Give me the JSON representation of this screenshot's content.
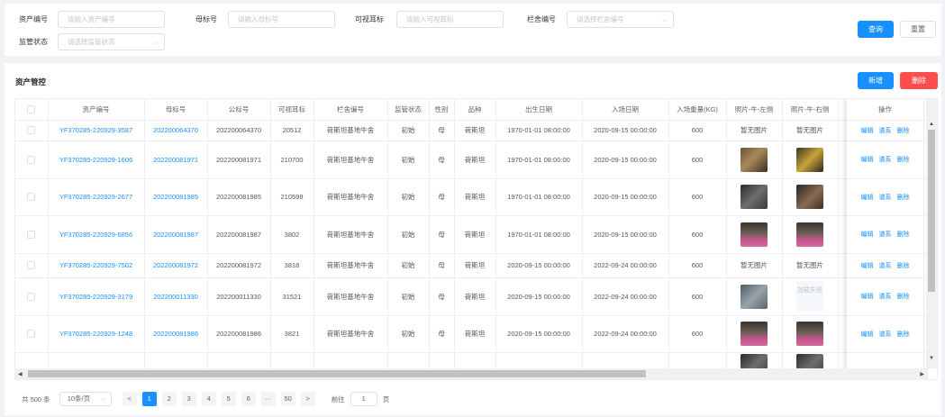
{
  "search": {
    "fields": [
      {
        "label": "资产编号",
        "placeholder": "请输入资产编号"
      },
      {
        "label": "母标号",
        "placeholder": "请输入母标号"
      },
      {
        "label": "可视耳标",
        "placeholder": "请输入可视耳标"
      },
      {
        "label": "栏舍编号",
        "placeholder": "请选择栏舍编号"
      },
      {
        "label": "监管状态",
        "placeholder": "请选择监管状态"
      }
    ],
    "query_label": "查询",
    "reset_label": "重置"
  },
  "section": {
    "title": "资产管控",
    "add_label": "新增",
    "delete_label": "删除"
  },
  "table": {
    "headers": [
      "资产编号",
      "母标号",
      "公标号",
      "可视耳标",
      "栏舍编号",
      "监管状态",
      "性别",
      "品种",
      "出生日期",
      "入场日期",
      "入场重量(KG)",
      "照片-牛-左侧",
      "照片-牛-右侧",
      "操作"
    ],
    "actions": [
      "编辑",
      "谱系",
      "删除"
    ],
    "no_image_label": "暂无图片",
    "load_fail_label": "加载失败",
    "rows": [
      {
        "asset": "YF370285-220929-3587",
        "mother": "202200064370",
        "public": "202200064370",
        "ear": "20512",
        "pen": "荷斯坦基地牛舍",
        "status": "初始",
        "sex": "母",
        "breed": "荷斯坦",
        "birth": "1970-01-01 08:00:00",
        "entry": "2020-09-15 00:00:00",
        "weight": "600",
        "left": "none",
        "right": "none"
      },
      {
        "asset": "YF370285-220929-1606",
        "mother": "202200081971",
        "public": "202200081971",
        "ear": "210700",
        "pen": "荷斯坦基地牛舍",
        "status": "初始",
        "sex": "母",
        "breed": "荷斯坦",
        "birth": "1970-01-01 08:00:00",
        "entry": "2020-09-15 00:00:00",
        "weight": "600",
        "left": "brown",
        "right": "yellow"
      },
      {
        "asset": "YF370285-220929-2677",
        "mother": "202200081985",
        "public": "202200081985",
        "ear": "210598",
        "pen": "荷斯坦基地牛舍",
        "status": "初始",
        "sex": "母",
        "breed": "荷斯坦",
        "birth": "1970-01-01 08:00:00",
        "entry": "2020-09-15 00:00:00",
        "weight": "600",
        "left": "dark",
        "right": "darkbrown"
      },
      {
        "asset": "YF370285-220929-6856",
        "mother": "202200081987",
        "public": "202200081987",
        "ear": "3802",
        "pen": "荷斯坦基地牛舍",
        "status": "初始",
        "sex": "母",
        "breed": "荷斯坦",
        "birth": "1970-01-01 08:00:00",
        "entry": "2020-09-15 00:00:00",
        "weight": "600",
        "left": "pink",
        "right": "pink"
      },
      {
        "asset": "YF370285-220929-7502",
        "mother": "202200081972",
        "public": "202200081972",
        "ear": "3818",
        "pen": "荷斯坦基地牛舍",
        "status": "初始",
        "sex": "母",
        "breed": "荷斯坦",
        "birth": "2020-09-15 00:00:00",
        "entry": "2022-09-24 00:00:00",
        "weight": "600",
        "left": "none",
        "right": "none"
      },
      {
        "asset": "YF370285-220929-3179",
        "mother": "202200011330",
        "public": "202200011330",
        "ear": "31521",
        "pen": "荷斯坦基地牛舍",
        "status": "初始",
        "sex": "母",
        "breed": "荷斯坦",
        "birth": "2020-09-15 00:00:00",
        "entry": "2022-09-24 00:00:00",
        "weight": "600",
        "left": "grey",
        "right": "fail"
      },
      {
        "asset": "YF370285-220929-1248",
        "mother": "202200081986",
        "public": "202200081986",
        "ear": "3821",
        "pen": "荷斯坦基地牛舍",
        "status": "初始",
        "sex": "母",
        "breed": "荷斯坦",
        "birth": "2020-09-15 00:00:00",
        "entry": "2022-09-24 00:00:00",
        "weight": "600",
        "left": "pink",
        "right": "pink"
      },
      {
        "asset": "",
        "mother": "",
        "public": "",
        "ear": "",
        "pen": "",
        "status": "",
        "sex": "",
        "breed": "",
        "birth": "",
        "entry": "",
        "weight": "",
        "left": "dark",
        "right": "dark"
      }
    ]
  },
  "pagination": {
    "total": "共 500 条",
    "page_size": "10条/页",
    "prev": "<",
    "next": ">",
    "pages": [
      "1",
      "2",
      "3",
      "4",
      "5",
      "6",
      "···",
      "50"
    ],
    "goto_label": "前往",
    "goto_value": "1",
    "page_suffix": "页"
  },
  "colors": {
    "primary": "#1890ff",
    "danger": "#ff4d4f"
  }
}
